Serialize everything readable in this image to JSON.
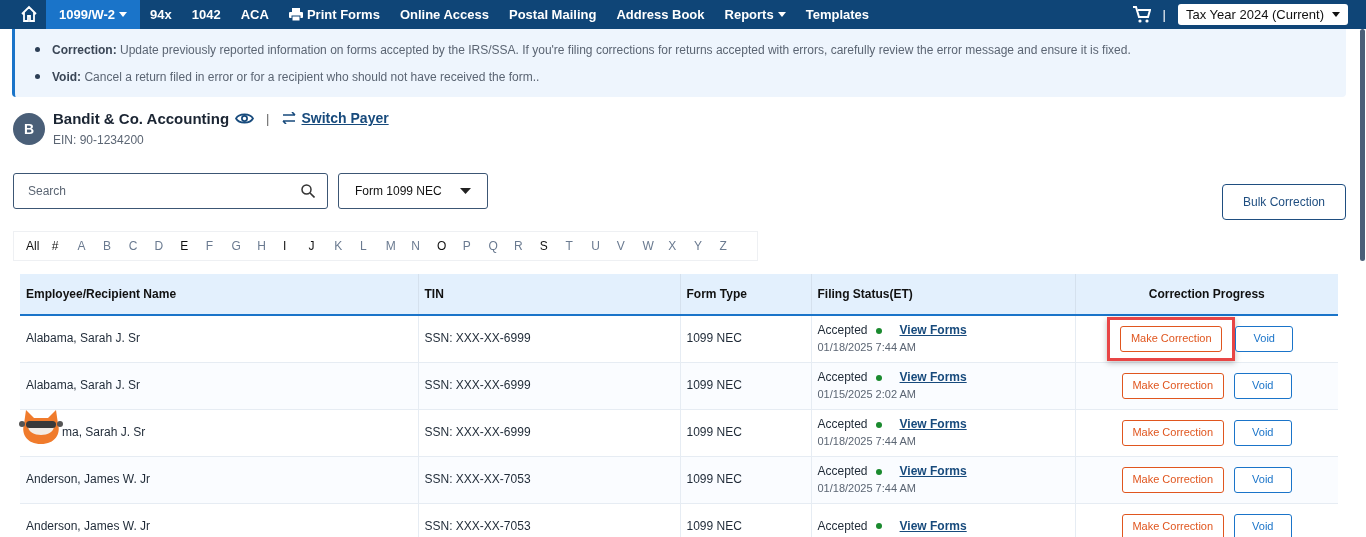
{
  "nav": {
    "tabs": [
      {
        "label": "1099/W-2",
        "selected": true,
        "dropdown": true,
        "has_icon": false
      },
      {
        "label": "94x",
        "selected": false,
        "dropdown": false,
        "has_icon": false
      },
      {
        "label": "1042",
        "selected": false,
        "dropdown": false,
        "has_icon": false
      },
      {
        "label": "ACA",
        "selected": false,
        "dropdown": false,
        "has_icon": false
      },
      {
        "label": "Print Forms",
        "selected": false,
        "dropdown": false,
        "has_icon": true
      },
      {
        "label": "Online Access",
        "selected": false,
        "dropdown": false,
        "has_icon": false
      },
      {
        "label": "Postal Mailing",
        "selected": false,
        "dropdown": false,
        "has_icon": false
      },
      {
        "label": "Address Book",
        "selected": false,
        "dropdown": false,
        "has_icon": false
      },
      {
        "label": "Reports",
        "selected": false,
        "dropdown": true,
        "has_icon": false
      },
      {
        "label": "Templates",
        "selected": false,
        "dropdown": false,
        "has_icon": false
      }
    ],
    "separator": "|",
    "tax_year": "Tax Year 2024 (Current)"
  },
  "notice": [
    {
      "term": "Correction:",
      "text": "Update previously reported information on forms accepted by the IRS/SSA. If you're filing corrections for returns accepted with errors, carefully review the error message and ensure it is fixed."
    },
    {
      "term": "Void:",
      "text": "Cancel a return filed in error or for a recipient who should not have received the form.."
    }
  ],
  "payer": {
    "initial": "B",
    "name": "Bandit & Co. Accounting",
    "separator": "|",
    "switch_link": "Switch Payer",
    "ein": "EIN: 90-1234200"
  },
  "search": {
    "placeholder": "Search"
  },
  "form_select": {
    "value": "Form 1099 NEC"
  },
  "bulk_button": "Bulk Correction",
  "letters": [
    {
      "label": "All",
      "selected": true
    },
    {
      "label": "#",
      "selected": true
    },
    {
      "label": "A",
      "selected": false
    },
    {
      "label": "B",
      "selected": false
    },
    {
      "label": "C",
      "selected": false
    },
    {
      "label": "D",
      "selected": false
    },
    {
      "label": "E",
      "selected": true
    },
    {
      "label": "F",
      "selected": false
    },
    {
      "label": "G",
      "selected": false
    },
    {
      "label": "H",
      "selected": false
    },
    {
      "label": "I",
      "selected": true
    },
    {
      "label": "J",
      "selected": true
    },
    {
      "label": "K",
      "selected": false
    },
    {
      "label": "L",
      "selected": false
    },
    {
      "label": "M",
      "selected": false
    },
    {
      "label": "N",
      "selected": false
    },
    {
      "label": "O",
      "selected": true
    },
    {
      "label": "P",
      "selected": false
    },
    {
      "label": "Q",
      "selected": false
    },
    {
      "label": "R",
      "selected": false
    },
    {
      "label": "S",
      "selected": true
    },
    {
      "label": "T",
      "selected": false
    },
    {
      "label": "U",
      "selected": false
    },
    {
      "label": "V",
      "selected": false
    },
    {
      "label": "W",
      "selected": false
    },
    {
      "label": "X",
      "selected": false
    },
    {
      "label": "Y",
      "selected": false
    },
    {
      "label": "Z",
      "selected": false
    }
  ],
  "table": {
    "columns": [
      "Employee/Recipient Name",
      "TIN",
      "Form Type",
      "Filing Status(ET)",
      "Correction Progress"
    ],
    "rows": [
      {
        "name": "Alabama, Sarah J. Sr",
        "tin": "SSN: XXX-XX-6999",
        "form_type": "1099 NEC",
        "status": "Accepted",
        "link": "View Forms",
        "date": "01/18/2025 7:44 AM",
        "correct": "Make Correction",
        "void": "Void",
        "highlighted": true,
        "mascot": false
      },
      {
        "name": "Alabama, Sarah J. Sr",
        "tin": "SSN: XXX-XX-6999",
        "form_type": "1099 NEC",
        "status": "Accepted",
        "link": "View Forms",
        "date": "01/15/2025 2:02 AM",
        "correct": "Make Correction",
        "void": "Void",
        "highlighted": false,
        "mascot": false
      },
      {
        "name": "ma, Sarah J. Sr",
        "tin": "SSN: XXX-XX-6999",
        "form_type": "1099 NEC",
        "status": "Accepted",
        "link": "View Forms",
        "date": "01/18/2025 7:44 AM",
        "correct": "Make Correction",
        "void": "Void",
        "highlighted": false,
        "mascot": true
      },
      {
        "name": "Anderson, James W. Jr",
        "tin": "SSN: XXX-XX-7053",
        "form_type": "1099 NEC",
        "status": "Accepted",
        "link": "View Forms",
        "date": "01/18/2025 7:44 AM",
        "correct": "Make Correction",
        "void": "Void",
        "highlighted": false,
        "mascot": false
      },
      {
        "name": "Anderson, James W. Jr",
        "tin": "SSN: XXX-XX-7053",
        "form_type": "1099 NEC",
        "status": "Accepted",
        "link": "View Forms",
        "correct": "Make Correction",
        "void": "Void",
        "highlighted": false,
        "mascot": false
      }
    ]
  }
}
